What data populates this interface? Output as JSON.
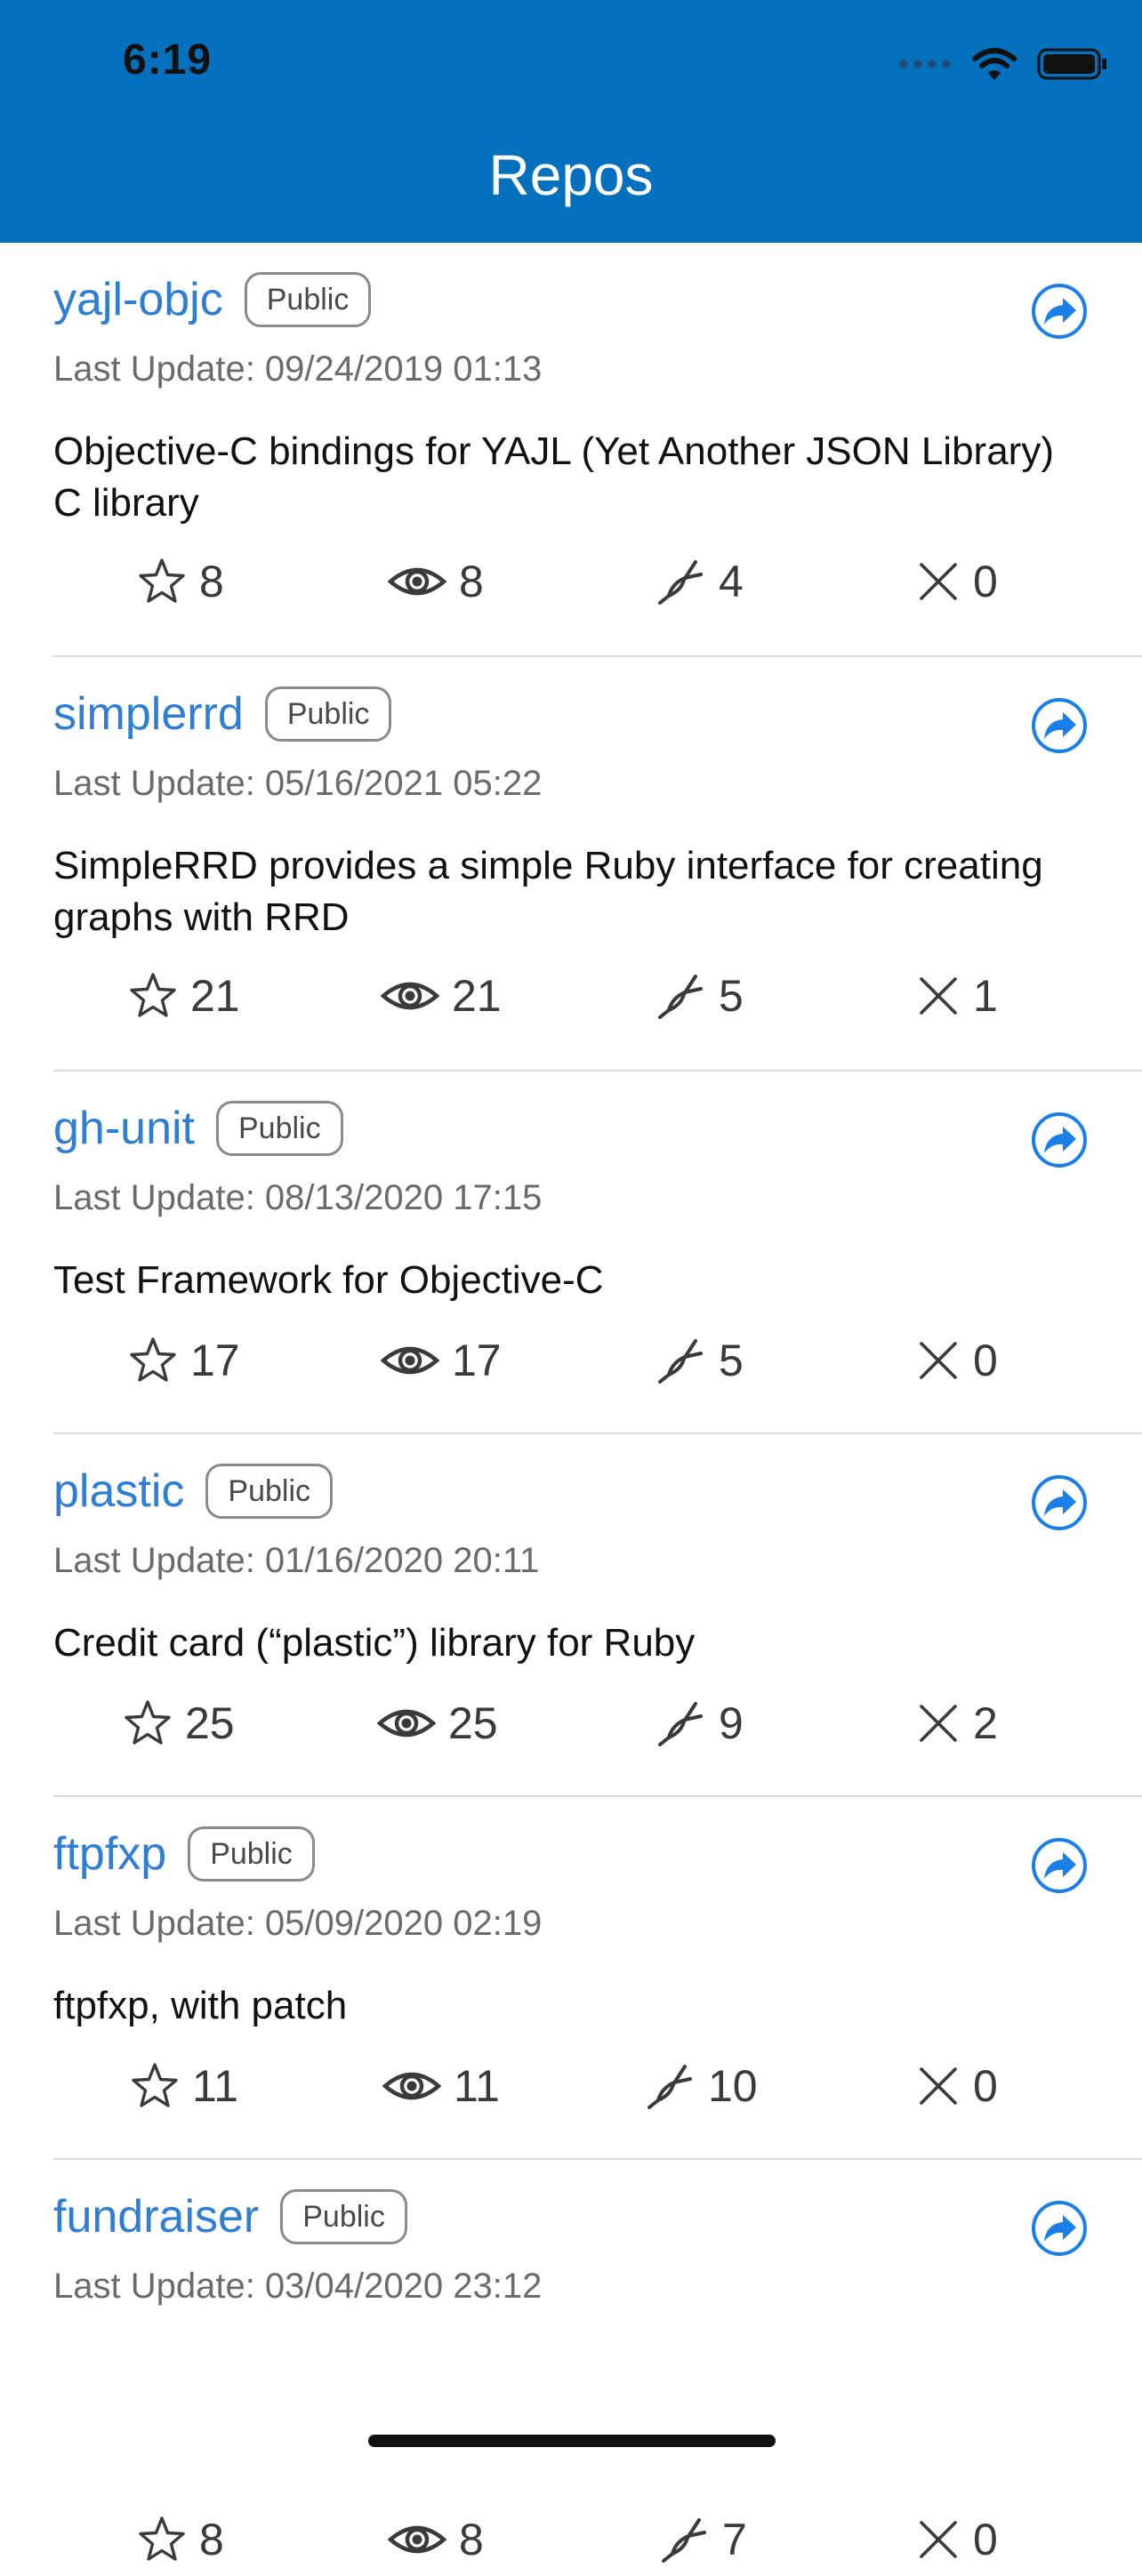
{
  "status_bar": {
    "time": "6:19"
  },
  "nav": {
    "title": "Repos"
  },
  "colors": {
    "nav_bg": "#0570bd",
    "link": "#2e7ed6",
    "share": "#1a7fe8"
  },
  "icons": {
    "stars": "star-icon",
    "watchers": "eye-icon",
    "forks": "fork-icon",
    "issues": "x-icon",
    "share": "share-arrow-icon"
  },
  "repos": [
    {
      "name": "yajl-objc",
      "visibility": "Public",
      "updated": "Last Update: 09/24/2019 01:13",
      "description": "Objective-C bindings for YAJL (Yet Another JSON Library) C library",
      "stars": "8",
      "watchers": "8",
      "forks": "4",
      "issues": "0"
    },
    {
      "name": "simplerrd",
      "visibility": "Public",
      "updated": "Last Update: 05/16/2021 05:22",
      "description": "SimpleRRD provides a simple Ruby interface for creating graphs with RRD",
      "stars": "21",
      "watchers": "21",
      "forks": "5",
      "issues": "1"
    },
    {
      "name": "gh-unit",
      "visibility": "Public",
      "updated": "Last Update: 08/13/2020 17:15",
      "description": "Test Framework for Objective-C",
      "stars": "17",
      "watchers": "17",
      "forks": "5",
      "issues": "0"
    },
    {
      "name": "plastic",
      "visibility": "Public",
      "updated": "Last Update: 01/16/2020 20:11",
      "description": "Credit card (“plastic”) library for Ruby",
      "stars": "25",
      "watchers": "25",
      "forks": "9",
      "issues": "2"
    },
    {
      "name": "ftpfxp",
      "visibility": "Public",
      "updated": "Last Update: 05/09/2020 02:19",
      "description": "ftpfxp, with patch",
      "stars": "11",
      "watchers": "11",
      "forks": "10",
      "issues": "0"
    },
    {
      "name": "fundraiser",
      "visibility": "Public",
      "updated": "Last Update: 03/04/2020 23:12",
      "description": "",
      "stars": "8",
      "watchers": "8",
      "forks": "7",
      "issues": "0"
    }
  ]
}
